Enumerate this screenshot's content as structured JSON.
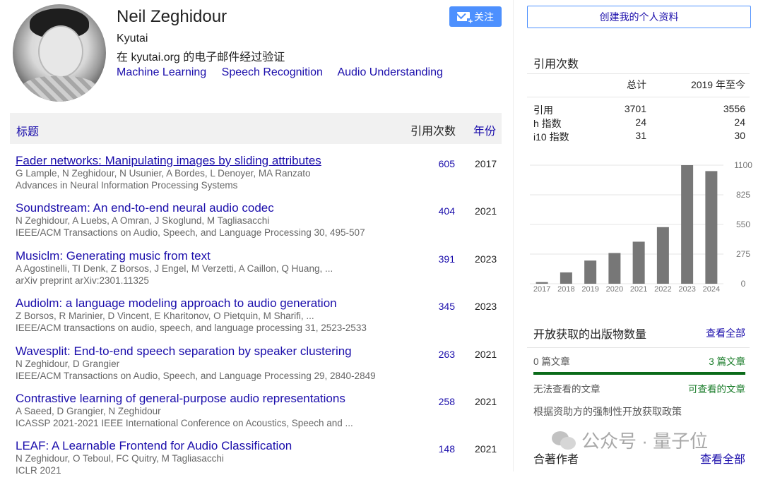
{
  "profile": {
    "name": "Neil Zeghidour",
    "affiliation": "Kyutai",
    "email_verified": "在 kyutai.org 的电子邮件经过验证",
    "interests": [
      "Machine Learning",
      "Speech Recognition",
      "Audio Understanding"
    ],
    "follow_label": "关注"
  },
  "table": {
    "col_title": "标题",
    "col_cites": "引用次数",
    "col_year": "年份",
    "rows": [
      {
        "title": "Fader networks: Manipulating images by sliding attributes",
        "authors": "G Lample, N Zeghidour, N Usunier, A Bordes, L Denoyer, MA Ranzato",
        "venue": "Advances in Neural Information Processing Systems",
        "cites": "605",
        "year": "2017"
      },
      {
        "title": "Soundstream: An end-to-end neural audio codec",
        "authors": "N Zeghidour, A Luebs, A Omran, J Skoglund, M Tagliasacchi",
        "venue": "IEEE/ACM Transactions on Audio, Speech, and Language Processing 30, 495-507",
        "cites": "404",
        "year": "2021"
      },
      {
        "title": "Musiclm: Generating music from text",
        "authors": "A Agostinelli, TI Denk, Z Borsos, J Engel, M Verzetti, A Caillon, Q Huang, ...",
        "venue": "arXiv preprint arXiv:2301.11325",
        "cites": "391",
        "year": "2023"
      },
      {
        "title": "Audiolm: a language modeling approach to audio generation",
        "authors": "Z Borsos, R Marinier, D Vincent, E Kharitonov, O Pietquin, M Sharifi, ...",
        "venue": "IEEE/ACM transactions on audio, speech, and language processing 31, 2523-2533",
        "cites": "345",
        "year": "2023"
      },
      {
        "title": "Wavesplit: End-to-end speech separation by speaker clustering",
        "authors": "N Zeghidour, D Grangier",
        "venue": "IEEE/ACM Transactions on Audio, Speech, and Language Processing 29, 2840-2849",
        "cites": "263",
        "year": "2021"
      },
      {
        "title": "Contrastive learning of general-purpose audio representations",
        "authors": "A Saeed, D Grangier, N Zeghidour",
        "venue": "ICASSP 2021-2021 IEEE International Conference on Acoustics, Speech and ...",
        "cites": "258",
        "year": "2021"
      },
      {
        "title": "LEAF: A Learnable Frontend for Audio Classification",
        "authors": "N Zeghidour, O Teboul, FC Quitry, M Tagliasacchi",
        "venue": "ICLR 2021",
        "cites": "148",
        "year": "2021"
      }
    ]
  },
  "sidebar": {
    "create_profile": "创建我的个人资料",
    "cited_by_title": "引用次数",
    "stats_headers": [
      "总计",
      "2019 年至今"
    ],
    "stats": [
      {
        "label": "引用",
        "total": "3701",
        "since": "3556"
      },
      {
        "label": "h 指数",
        "total": "24",
        "since": "24"
      },
      {
        "label": "i10 指数",
        "total": "31",
        "since": "30"
      }
    ],
    "oa_title": "开放获取的出版物数量",
    "view_all": "查看全部",
    "oa_unavailable_count": "0 篇文章",
    "oa_available_count": "3 篇文章",
    "oa_unavailable_label": "无法查看的文章",
    "oa_available_label": "可查看的文章",
    "oa_policy": "根据资助方的强制性开放获取政策",
    "coauthors_title": "合著作者",
    "coauthors_view_all": "查看全部"
  },
  "watermark": {
    "text": "公众号 · 量子位"
  },
  "colors": {
    "link": "#1a0dab",
    "accent": "#4d90fe",
    "bar": "#777777",
    "oa_green": "#0b6b1a"
  },
  "chart_data": {
    "type": "bar",
    "categories": [
      "2017",
      "2018",
      "2019",
      "2020",
      "2021",
      "2022",
      "2023",
      "2024"
    ],
    "values": [
      15,
      105,
      215,
      285,
      390,
      525,
      1100,
      1045
    ],
    "yticks": [
      "1100",
      "825",
      "550",
      "275",
      "0"
    ],
    "ylim": [
      0,
      1100
    ],
    "title": "",
    "xlabel": "",
    "ylabel": ""
  }
}
